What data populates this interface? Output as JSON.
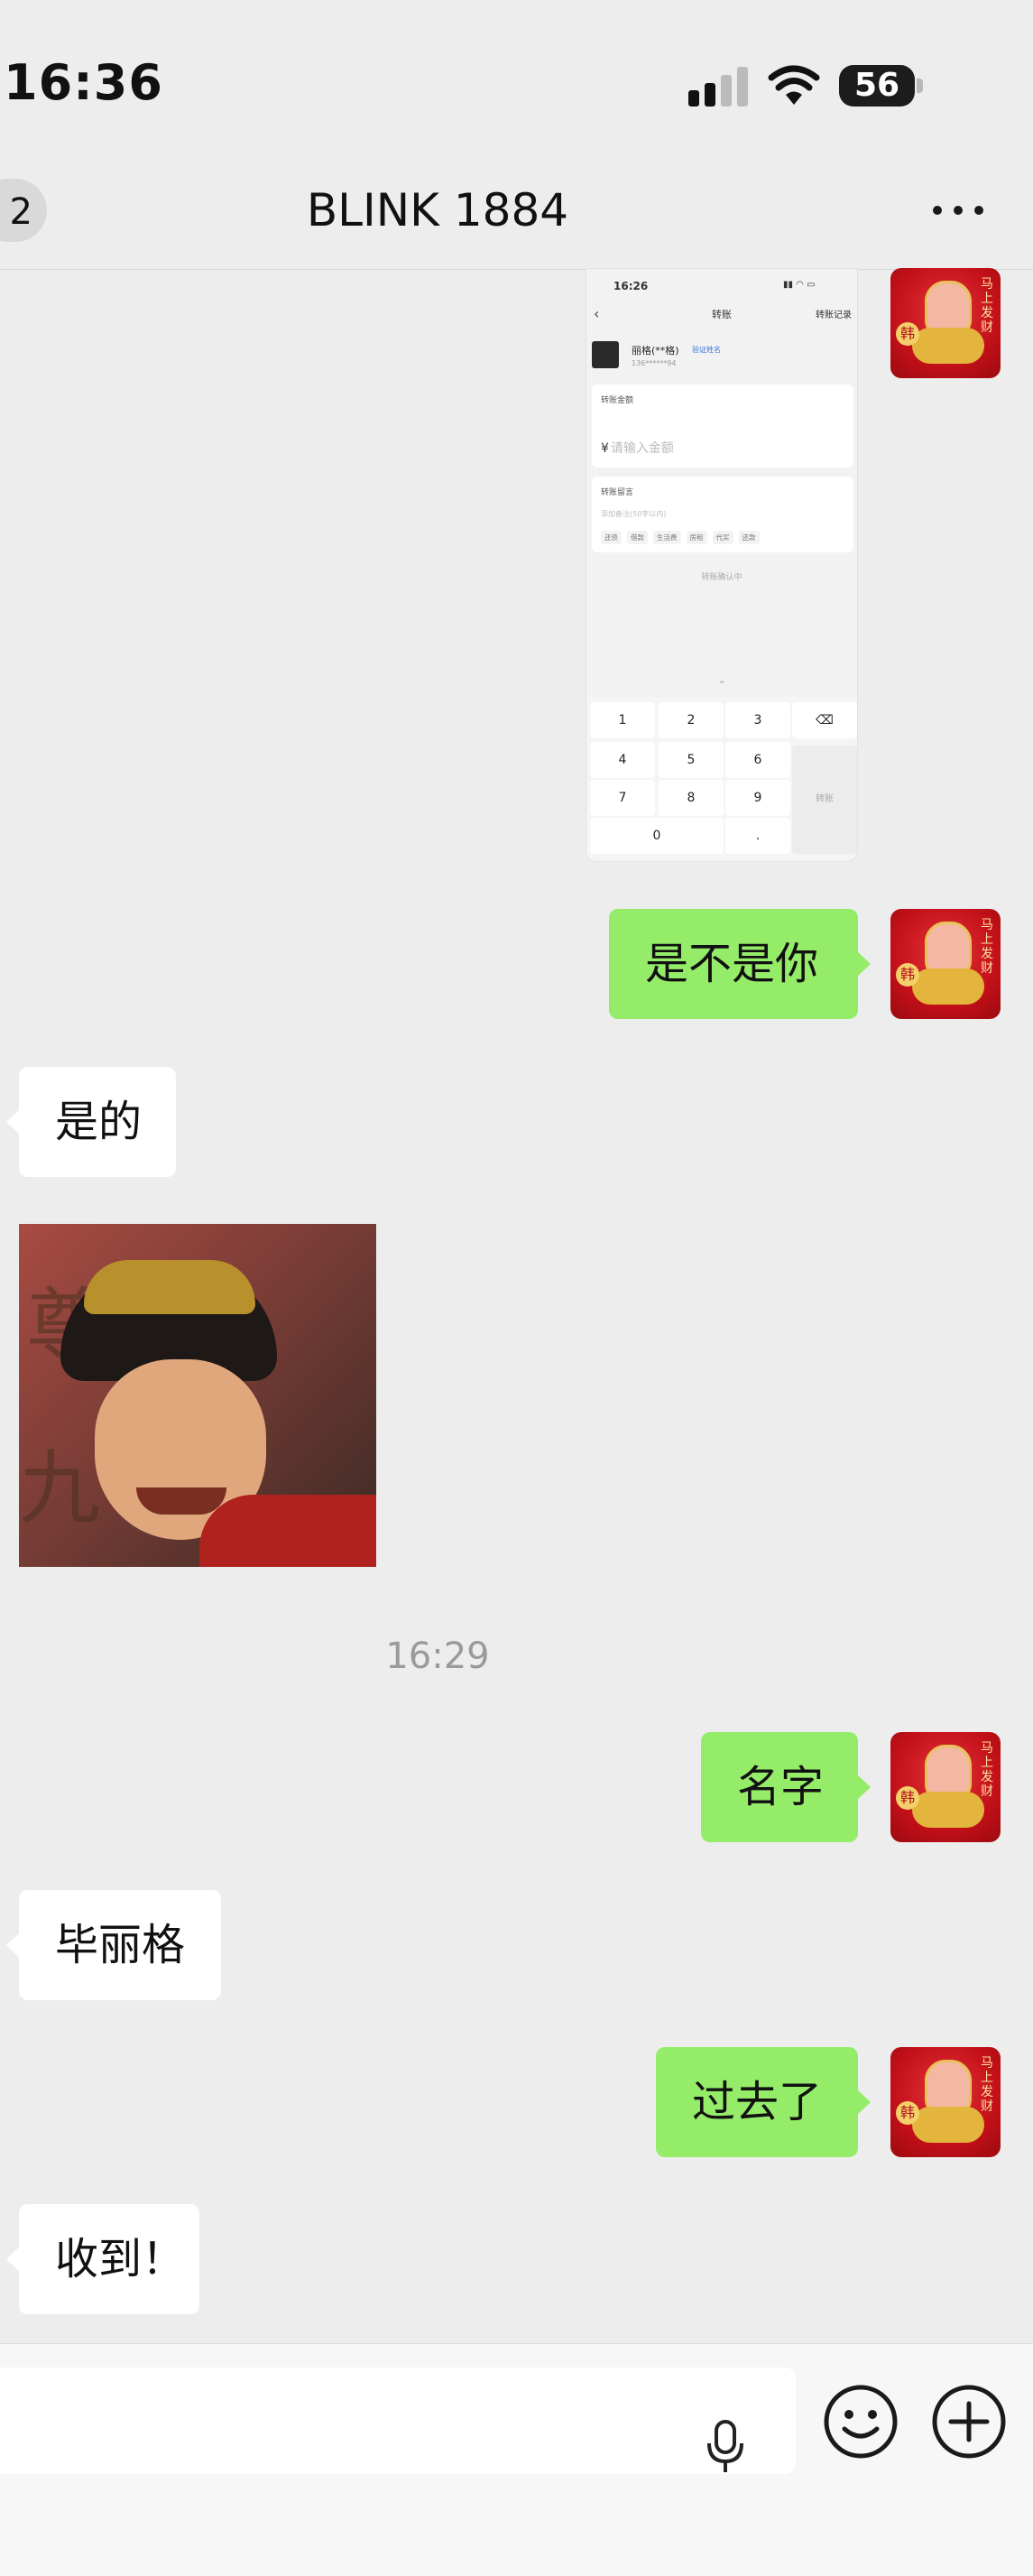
{
  "status_bar": {
    "time": "16:36",
    "battery": "56",
    "icons": [
      "signal-icon",
      "wifi-icon",
      "battery-icon"
    ]
  },
  "header": {
    "back_badge": "2",
    "title": "BLINK 1884",
    "more_icon": "more-icon"
  },
  "transfer_screenshot": {
    "time": "16:26",
    "title": "转账",
    "record_link": "转账记录",
    "payee_name": "丽格(**格)",
    "verified": "验证姓名",
    "payee_phone": "136******94",
    "amount_label": "转账金额",
    "currency": "¥",
    "amount_placeholder": "请输入金额",
    "note_label": "转账留言",
    "note_placeholder": "添加备注(50字以内)",
    "chips": [
      "还债",
      "借款",
      "生活费",
      "房租",
      "代买",
      "还款"
    ],
    "submit": "转账确认中",
    "keys": [
      "1",
      "2",
      "3",
      "4",
      "5",
      "6",
      "7",
      "8",
      "9",
      "0",
      "."
    ],
    "side_key": "转账"
  },
  "messages": [
    {
      "side": "sent",
      "text": "是不是你"
    },
    {
      "side": "recv",
      "text": "是的"
    },
    {
      "side": "recv",
      "text": "毕丽格"
    },
    {
      "side": "sent",
      "text": "名字"
    },
    {
      "side": "sent",
      "text": "过去了"
    },
    {
      "side": "recv",
      "text": "收到！"
    }
  ],
  "timestamp": "16:29",
  "avatar_calligraphy": "马上发财",
  "avatar_badge": "韩",
  "colors": {
    "sent_bubble": "#95ec69",
    "recv_bubble": "#ffffff",
    "chat_bg": "#ededed",
    "avatar_red": "#c41019"
  }
}
